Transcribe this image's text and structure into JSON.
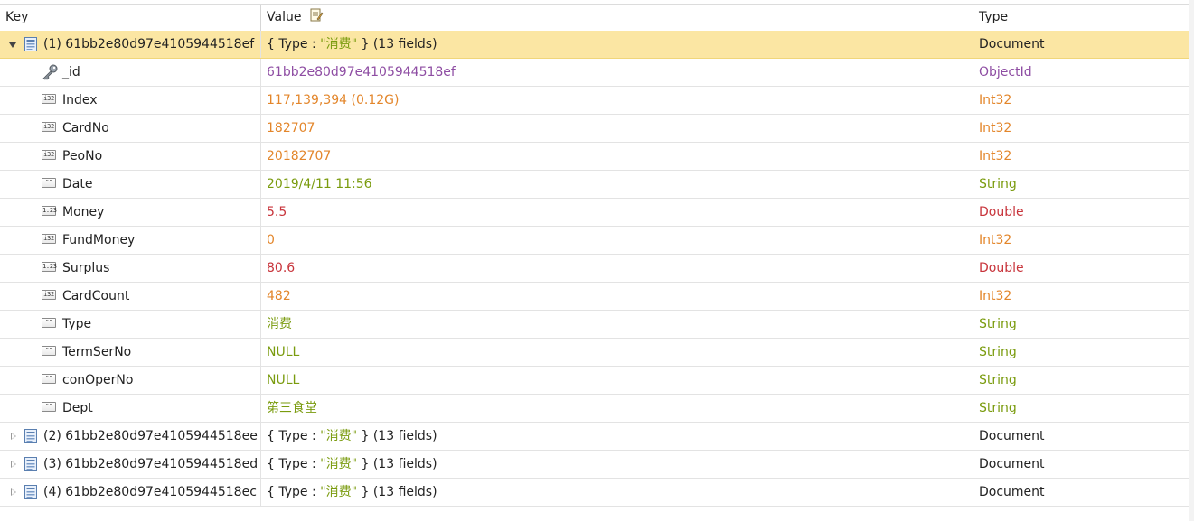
{
  "header": {
    "key": "Key",
    "value": "Value",
    "type": "Type"
  },
  "selected_document": {
    "label": "(1) 61bb2e80d97e4105944518ef",
    "value_prefix": "{ Type : ",
    "value_str": "\"消费\"",
    "value_suffix": " } (13 fields)",
    "type": "Document"
  },
  "fields": [
    {
      "name": "_id",
      "value": "61bb2e80d97e4105944518ef",
      "type": "ObjectId",
      "icon": "key-icon",
      "value_color": "#8e4da3",
      "type_color": "#8e4da3"
    },
    {
      "name": "Index",
      "value": "117,139,394 (0.12G)",
      "type": "Int32",
      "icon": "i32",
      "value_color": "#e3862b",
      "type_color": "#e3862b"
    },
    {
      "name": "CardNo",
      "value": "182707",
      "type": "Int32",
      "icon": "i32",
      "value_color": "#e3862b",
      "type_color": "#e3862b"
    },
    {
      "name": "PeoNo",
      "value": "20182707",
      "type": "Int32",
      "icon": "i32",
      "value_color": "#e3862b",
      "type_color": "#e3862b"
    },
    {
      "name": "Date",
      "value": "2019/4/11 11:56",
      "type": "String",
      "icon": "str",
      "value_color": "#7a9b0e",
      "type_color": "#7a9b0e"
    },
    {
      "name": "Money",
      "value": "5.5",
      "type": "Double",
      "icon": "dbl",
      "value_color": "#c8343b",
      "type_color": "#c8343b"
    },
    {
      "name": "FundMoney",
      "value": "0",
      "type": "Int32",
      "icon": "i32",
      "value_color": "#e3862b",
      "type_color": "#e3862b"
    },
    {
      "name": "Surplus",
      "value": "80.6",
      "type": "Double",
      "icon": "dbl",
      "value_color": "#c8343b",
      "type_color": "#c8343b"
    },
    {
      "name": "CardCount",
      "value": "482",
      "type": "Int32",
      "icon": "i32",
      "value_color": "#e3862b",
      "type_color": "#e3862b"
    },
    {
      "name": "Type",
      "value": "消费",
      "type": "String",
      "icon": "str",
      "value_color": "#7a9b0e",
      "type_color": "#7a9b0e"
    },
    {
      "name": "TermSerNo",
      "value": "NULL",
      "type": "String",
      "icon": "str",
      "value_color": "#7a9b0e",
      "type_color": "#7a9b0e"
    },
    {
      "name": "conOperNo",
      "value": "NULL",
      "type": "String",
      "icon": "str",
      "value_color": "#7a9b0e",
      "type_color": "#7a9b0e"
    },
    {
      "name": "Dept",
      "value": "第三食堂",
      "type": "String",
      "icon": "str",
      "value_color": "#7a9b0e",
      "type_color": "#7a9b0e"
    }
  ],
  "other_documents": [
    {
      "label": "(2) 61bb2e80d97e4105944518ee",
      "value_prefix": "{ Type : ",
      "value_str": "\"消费\"",
      "value_suffix": " } (13 fields)",
      "type": "Document"
    },
    {
      "label": "(3) 61bb2e80d97e4105944518ed",
      "value_prefix": "{ Type : ",
      "value_str": "\"消费\"",
      "value_suffix": " } (13 fields)",
      "type": "Document"
    },
    {
      "label": "(4) 61bb2e80d97e4105944518ec",
      "value_prefix": "{ Type : ",
      "value_str": "\"消费\"",
      "value_suffix": " } (13 fields)",
      "type": "Document"
    }
  ],
  "icon_tags": {
    "i32": "i32",
    "str": "\"\"",
    "dbl": "1.23"
  }
}
